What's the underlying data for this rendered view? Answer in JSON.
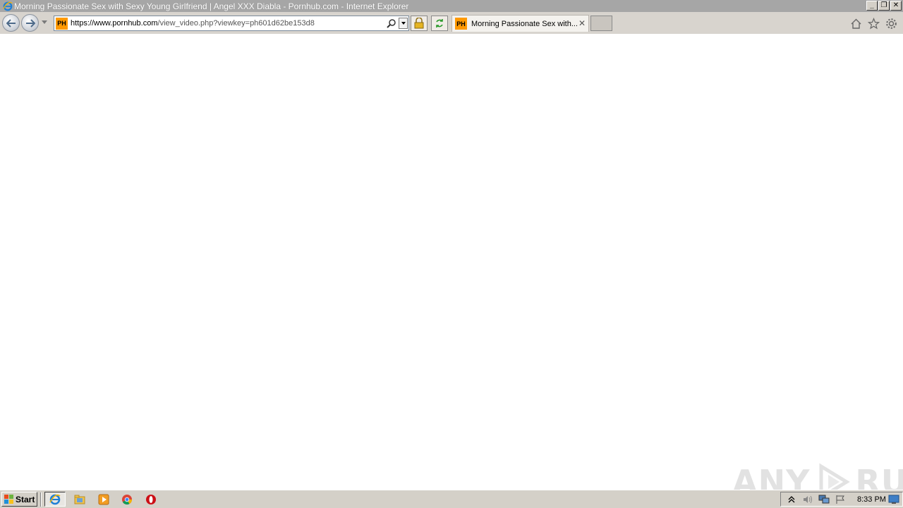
{
  "window": {
    "title": "Morning Passionate Sex with Sexy Young Girlfriend | Angel XXX Diabla - Pornhub.com - Internet Explorer",
    "buttons": {
      "minimize": "_",
      "restore": "❐",
      "close": "✕"
    }
  },
  "navbar": {
    "favicon_text": "PH",
    "url_domain": "https://www.pornhub.com",
    "url_path": "/view_video.php?viewkey=ph601d62be153d8"
  },
  "tabs": [
    {
      "favicon_text": "PH",
      "title": "Morning Passionate Sex with...",
      "close": "✕"
    }
  ],
  "icons": {
    "ie": "internet-explorer-icon",
    "back": "back-arrow-icon",
    "forward": "forward-arrow-icon",
    "search": "search-icon",
    "lock": "lock-icon",
    "refresh": "refresh-icon",
    "home": "home-icon",
    "favorites": "star-icon",
    "tools": "gear-icon"
  },
  "taskbar": {
    "start_label": "Start",
    "apps": [
      "internet-explorer",
      "file-explorer",
      "media-player",
      "chrome",
      "opera"
    ],
    "tray": [
      "show-hidden-icons",
      "volume",
      "network",
      "action-center-flag"
    ],
    "clock": "8:33 PM"
  },
  "watermark": {
    "left": "ANY",
    "right": "RUN"
  },
  "colors": {
    "titlebar": "#a6a6a6",
    "toolbar": "#d8d4ce",
    "taskbar": "#d4d0c8",
    "ph_orange": "#ff9900"
  }
}
